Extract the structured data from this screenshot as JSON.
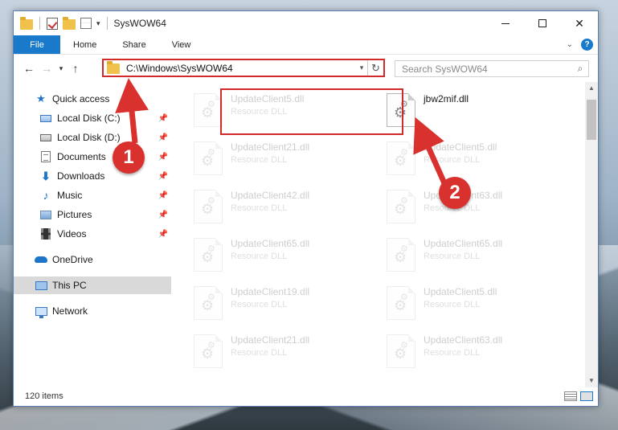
{
  "window": {
    "title": "SysWOW64",
    "minimize": "—",
    "maximize": "",
    "close": "✕"
  },
  "ribbon": {
    "tabs": [
      "File",
      "Home",
      "Share",
      "View"
    ],
    "help": "?"
  },
  "nav": {
    "back": "←",
    "forward": "→",
    "recent": "▾",
    "up": "↑",
    "address": "C:\\Windows\\SysWOW64",
    "refresh": "↻",
    "search_placeholder": "Search SysWOW64",
    "search_icon": "search-icon"
  },
  "sidebar": {
    "items": [
      {
        "label": "Quick access",
        "icon": "star-icon"
      },
      {
        "label": "Local Disk (C:)",
        "icon": "drive-icon",
        "pinned": true
      },
      {
        "label": "Local Disk (D:)",
        "icon": "drive-icon",
        "pinned": true
      },
      {
        "label": "Documents",
        "icon": "documents-icon",
        "pinned": true
      },
      {
        "label": "Downloads",
        "icon": "downloads-icon",
        "pinned": true
      },
      {
        "label": "Music",
        "icon": "music-icon",
        "pinned": true
      },
      {
        "label": "Pictures",
        "icon": "pictures-icon",
        "pinned": true
      },
      {
        "label": "Videos",
        "icon": "videos-icon",
        "pinned": true
      },
      {
        "label": "OneDrive",
        "icon": "onedrive-icon"
      },
      {
        "label": "This PC",
        "icon": "pc-icon",
        "selected": true
      },
      {
        "label": "Network",
        "icon": "network-icon"
      }
    ]
  },
  "files": [
    {
      "name": "UpdateClient5.dll",
      "type": "Resource DLL",
      "faded": true
    },
    {
      "name": "jbw2mif.dll",
      "type": "",
      "faded": false,
      "highlighted": true
    },
    {
      "name": "UpdateClient21.dll",
      "type": "Resource DLL",
      "faded": true
    },
    {
      "name": "UpdateClient5.dll",
      "type": "Resource DLL",
      "faded": true
    },
    {
      "name": "UpdateClient42.dll",
      "type": "Resource DLL",
      "faded": true
    },
    {
      "name": "UpdateClient63.dll",
      "type": "Resource DLL",
      "faded": true
    },
    {
      "name": "UpdateClient65.dll",
      "type": "Resource DLL",
      "faded": true
    },
    {
      "name": "UpdateClient65.dll",
      "type": "Resource DLL",
      "faded": true
    },
    {
      "name": "UpdateClient19.dll",
      "type": "Resource DLL",
      "faded": true
    },
    {
      "name": "UpdateClient5.dll",
      "type": "Resource DLL",
      "faded": true
    },
    {
      "name": "UpdateClient21.dll",
      "type": "Resource DLL",
      "faded": true
    },
    {
      "name": "UpdateClient63.dll",
      "type": "Resource DLL",
      "faded": true
    }
  ],
  "status": {
    "item_count": "120 items"
  },
  "annotations": {
    "step1": "1",
    "step2": "2",
    "color": "#d8312e"
  },
  "colors": {
    "accent": "#1979ca",
    "highlight": "#d12a2a"
  }
}
